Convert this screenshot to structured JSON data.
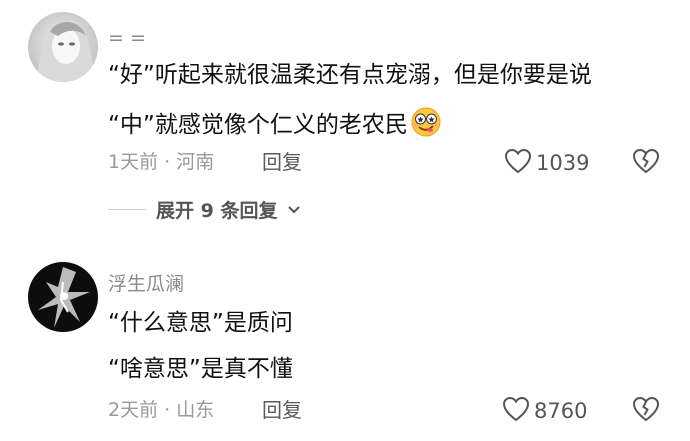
{
  "comments": [
    {
      "username": "= =",
      "lines": [
        "“好”听起来就很温柔还有点宠溺，但是你要是说",
        "“中”就感觉像个仁义的老农民"
      ],
      "emoji_icon": "face-with-heart-eyes-emoji",
      "time": "1天前",
      "separator": "·",
      "location": "河南",
      "reply_label": "回复",
      "like_count": "1039",
      "expand_replies_label": "展开 9 条回复"
    },
    {
      "username": "浮生瓜澜",
      "lines": [
        "“什么意思”是质问",
        "“啥意思”是真不懂"
      ],
      "time": "2天前",
      "separator": "·",
      "location": "山东",
      "reply_label": "回复",
      "like_count": "8760"
    }
  ],
  "icons": {
    "like": "heart-outline-icon",
    "dislike": "broken-heart-icon",
    "expand": "chevron-down-icon"
  }
}
